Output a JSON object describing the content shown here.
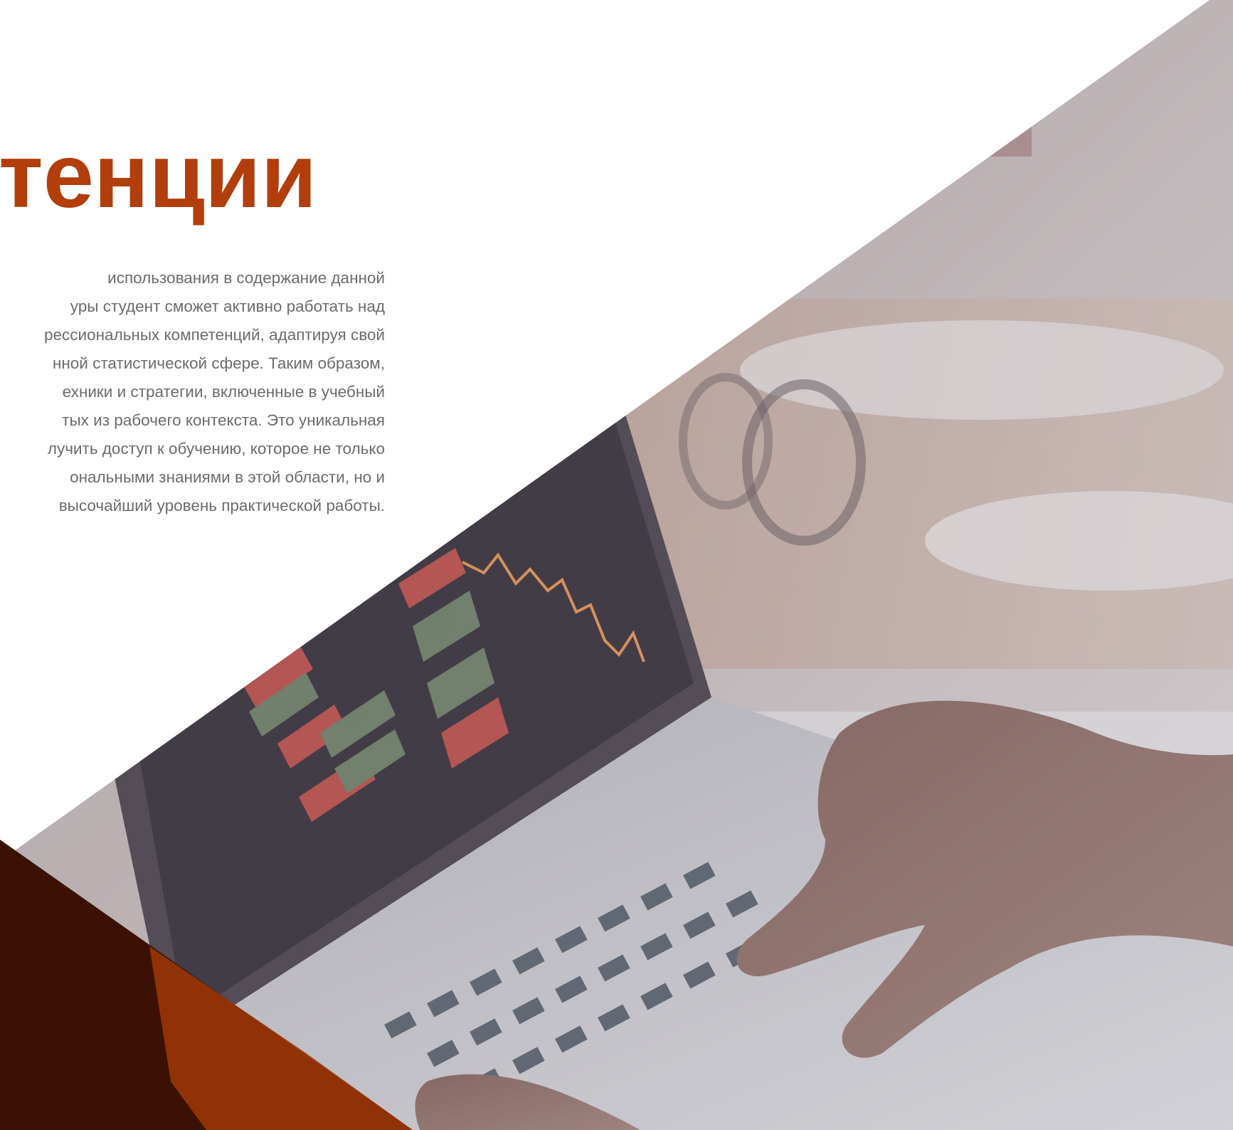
{
  "heading": {
    "text": "тенции",
    "color": "#B13E0B"
  },
  "body": {
    "lines": [
      "использования в содержание данной",
      "уры студент сможет активно работать над",
      "рессиональных компетенций, адаптируя свой",
      "нной статистической сфере. Таким образом,",
      "ехники и стратегии, включенные в учебный",
      "тых из рабочего контекста. Это уникальная",
      "лучить доступ к обучению, которое не только",
      "ональными знаниями в этой области, но и",
      "высочайший уровень практической работы."
    ]
  },
  "colors": {
    "background": "#ffffff",
    "accent_dark": "#3B1104",
    "accent_orange": "#9A3607",
    "photo_overlay": "#5E5660",
    "text_gray": "#6b6b6b"
  },
  "image": {
    "subject": "hands typing on a laptop showing a stock trading chart",
    "icon": "laptop-trading-photo"
  }
}
